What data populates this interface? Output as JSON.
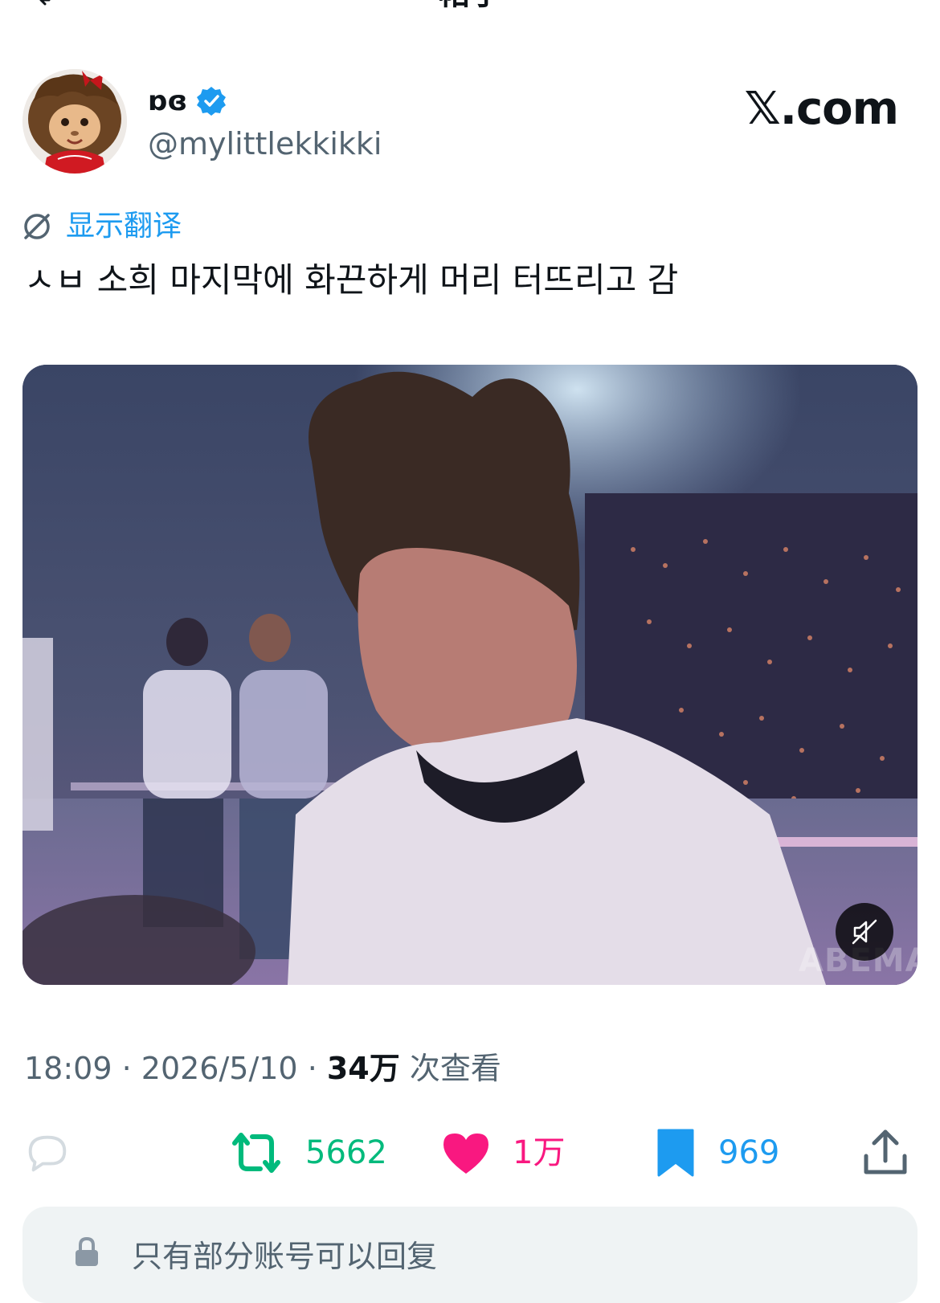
{
  "header": {
    "title": "帖子"
  },
  "author": {
    "display_name": "ɒɞ",
    "handle": "@mylittlekkikki",
    "verified": true
  },
  "site_label": "𝕏.com",
  "translate": {
    "label": "显示翻译"
  },
  "post": {
    "text": "ㅅㅂ 소희 마지막에 화끈하게 머리 터뜨리고 감"
  },
  "media": {
    "watermark": "ABEMA",
    "muted": true
  },
  "meta": {
    "time": "18:09",
    "sep1": " · ",
    "date": "2026/5/10",
    "sep2": " · ",
    "views_count": "34万",
    "views_label": " 次查看"
  },
  "actions": {
    "reply_count": "",
    "retweet_count": "5662",
    "like_count": "1万",
    "bookmark_count": "969"
  },
  "reply_restriction": {
    "text": "只有部分账号可以回复"
  },
  "colors": {
    "accent": "#1d9bf0",
    "retweet": "#00ba7c",
    "like": "#f91880",
    "secondary_text": "#536471",
    "primary_text": "#0f1419"
  }
}
